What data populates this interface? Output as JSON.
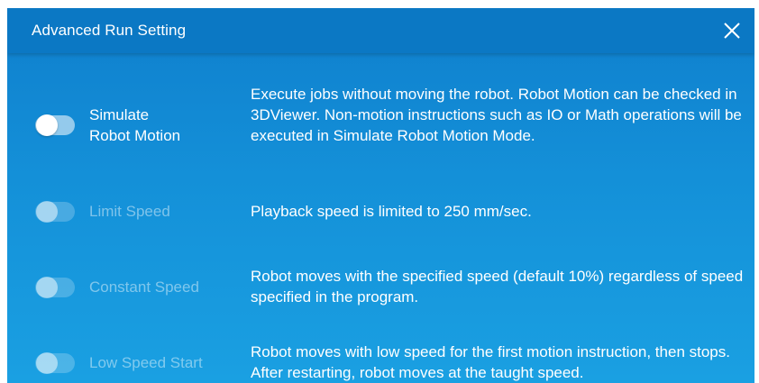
{
  "dialog": {
    "title": "Advanced Run Setting",
    "close_icon": "close-icon"
  },
  "settings": [
    {
      "label_line1": "Simulate",
      "label_line2": "Robot Motion",
      "enabled": true,
      "toggle_on": false,
      "description": "Execute jobs without moving the robot.  Robot Motion can be checked in 3DViewer.  Non-motion instructions such as IO or Math operations will be executed in Simulate Robot Motion Mode."
    },
    {
      "label": "Limit Speed",
      "enabled": false,
      "toggle_on": false,
      "description": "Playback speed is limited to 250 mm/sec."
    },
    {
      "label": "Constant Speed",
      "enabled": false,
      "toggle_on": false,
      "description": "Robot moves with the specified speed (default 10%) regardless of speed specified in the program."
    },
    {
      "label": "Low Speed Start",
      "enabled": false,
      "toggle_on": false,
      "description": "Robot moves with low speed for the first motion instruction, then stops.  After restarting, robot moves at the taught speed."
    }
  ],
  "colors": {
    "header": "#0b78c4",
    "body_top": "#0f7fcd",
    "body_bottom": "#1aa0e2",
    "text": "#ffffff"
  }
}
